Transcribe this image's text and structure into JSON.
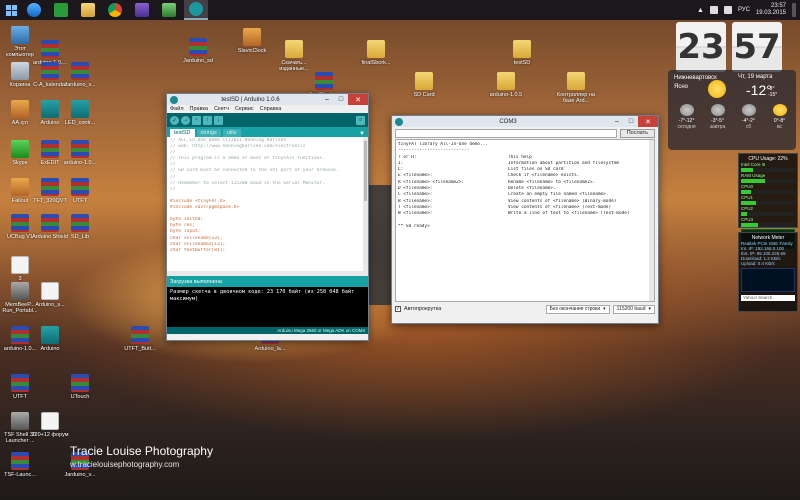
{
  "taskbar": {
    "buttons": [
      "ie",
      "store",
      "chrome",
      "video",
      "explorer",
      "task-manager",
      "arduino"
    ],
    "tray": {
      "lang": "РУС",
      "time": "23:57",
      "date": "19.03.2015"
    }
  },
  "desktop_icons": [
    {
      "label": "Этот компьютер",
      "kind": "pc"
    },
    {
      "label": "arduino-1.0....",
      "kind": "rar"
    },
    {
      "label": "Корзина",
      "kind": "bin"
    },
    {
      "label": "C-A_kalendar",
      "kind": "rar"
    },
    {
      "label": "Jarduino_v...",
      "kind": "rar"
    },
    {
      "label": "AA.q:n",
      "kind": "app"
    },
    {
      "label": "Arduino",
      "kind": "ard"
    },
    {
      "label": "LED_contr...",
      "kind": "ard"
    },
    {
      "label": "Skype",
      "kind": "green"
    },
    {
      "label": "ExEDIT",
      "kind": "rar"
    },
    {
      "label": "arduino-1.0...",
      "kind": "rar"
    },
    {
      "label": "Fallout",
      "kind": "app"
    },
    {
      "label": "TFT_320QVT",
      "kind": "rar"
    },
    {
      "label": "UTFT",
      "kind": "rar"
    },
    {
      "label": "UCBug V1",
      "kind": "rar"
    },
    {
      "label": "Arduino Shield",
      "kind": "rar"
    },
    {
      "label": "SD_Lib",
      "kind": "rar"
    },
    {
      "label": "3",
      "kind": "doc"
    },
    {
      "label": "MemBeeP... Run_Portabl...",
      "kind": "grey"
    },
    {
      "label": "Arduino_s...",
      "kind": "doc"
    },
    {
      "label": "arduino-1.0...",
      "kind": "rar"
    },
    {
      "label": "Arduino",
      "kind": "ard"
    },
    {
      "label": "UTFT_Butt...",
      "kind": "rar"
    },
    {
      "label": "Arduino_la...",
      "kind": "rar"
    },
    {
      "label": "UTFT",
      "kind": "rar"
    },
    {
      "label": "UTouch",
      "kind": "rar"
    },
    {
      "label": "TSF Shell 30 Launcher ...",
      "kind": "grey"
    },
    {
      "label": "220+12 форум",
      "kind": "doc"
    },
    {
      "label": "TSF-Launc...",
      "kind": "rar"
    },
    {
      "label": "Jarduino_v...",
      "kind": "rar"
    },
    {
      "label": "Jarduino_sd",
      "kind": "rar"
    },
    {
      "label": "SlavicClock",
      "kind": "app"
    },
    {
      "label": "Скачать... изданные...",
      "kind": "folder"
    },
    {
      "label": "finalSbork...",
      "kind": "folder"
    },
    {
      "label": "testSD",
      "kind": "folder"
    },
    {
      "label": "finalSbork...",
      "kind": "rar"
    },
    {
      "label": "SD Card",
      "kind": "folder"
    },
    {
      "label": "arduino-1.0.5",
      "kind": "folder"
    },
    {
      "label": "Контроллер на базе Ard...",
      "kind": "folder"
    }
  ],
  "ide": {
    "title": "testSD | Arduino 1.0.6",
    "menu": [
      "Файл",
      "Правка",
      "Скетч",
      "Сервис",
      "Справка"
    ],
    "tabs": [
      "testSD",
      "strings",
      "utils"
    ],
    "code": [
      "// ALL_In_One_Demo (C)2011 Henning Karlsen",
      "// web: http://www.henningkarlsen.com/electronics",
      "//",
      "// This program is a demo of most of tinyFATs functions.",
      "//",
      "// SD card must be connected to the SPI port of your Arduino.",
      "//",
      "// Remember to select 115200 baud in the Serial Monitor.",
      "//",
      "",
      "#include <tinyFAT.h>",
      "#include <avr/pgmspace.h>",
      "",
      "byte inited;",
      "byte res;",
      "byte input;",
      "char sFilename[13];",
      "char sFilename2[13];",
      "char textBuffer[81];"
    ],
    "status": "Загрузка выполнена",
    "console": [
      "Размер скетча в двоичном коде: 23 170 байт (из 258 048 байт",
      "максимум)"
    ],
    "board": "Arduino Mega 2560 or Mega ADK on COM3"
  },
  "serial": {
    "title": "COM3",
    "send_label": "Послать",
    "lines": [
      {
        "c1": "tinyFAT library All-In-One demo...",
        "c2": ""
      },
      {
        "c1": "---------------------------",
        "c2": ""
      },
      {
        "c1": "? or H:",
        "c2": "This help"
      },
      {
        "c1": "I:",
        "c2": "Information about partition and filesystem"
      },
      {
        "c1": "L:",
        "c2": "List files on SD card"
      },
      {
        "c1": "E <filename>:",
        "c2": "Check if <filename> exists."
      },
      {
        "c1": "R <filename> <filename2>:",
        "c2": "Rename <filename> to <filename2>."
      },
      {
        "c1": "D <filename>:",
        "c2": "Delete <filename>."
      },
      {
        "c1": "C <filename>:",
        "c2": "Create an empty file named <filename>."
      },
      {
        "c1": "B <filename>:",
        "c2": "View contents of <filename> (Binary-mode)"
      },
      {
        "c1": "T <filename>:",
        "c2": "View contents of <filename> (Text-mode)"
      },
      {
        "c1": "W <filename>:",
        "c2": "Write a line of text to <filename> (Text-mode)"
      },
      {
        "c1": "",
        "c2": ""
      },
      {
        "c1": "** SD ready>",
        "c2": ""
      }
    ],
    "autoscroll": "Автопрокрутка",
    "line_ending": "Без окончания строки",
    "baud": "115200 baud"
  },
  "gadgets": {
    "hours": "23",
    "minutes": "57",
    "city": "Нижневартовск",
    "condition": "Ясно",
    "date": "Чт, 19 марта",
    "temp": "-12°",
    "range": [
      "-3°",
      "-15°"
    ],
    "forecast": [
      {
        "t": "-7°-12°",
        "d": "сегодня"
      },
      {
        "t": "-3°-5°",
        "d": "завтра"
      },
      {
        "t": "-4°-2°",
        "d": "сб"
      },
      {
        "t": "0°-8°",
        "d": "вс"
      }
    ],
    "cpu_title": "CPU Usage: 22%",
    "cpu_lines": [
      "Intel Core i5",
      "RAM Usage",
      "CPU0",
      "CPU1",
      "CPU2",
      "CPU3"
    ],
    "cpu_values": [
      0.22,
      0.45,
      0.18,
      0.27,
      0.12,
      0.31
    ],
    "net_title": "Network Meter",
    "net_lines": [
      "Realtek PCIe GBE Family",
      "Int. IP: 192.168.0.100",
      "Ext. IP: 95.105.226.69",
      "Download: 1.2 KB/s",
      "Upload: 0.4 KB/s"
    ],
    "net_search": "Yahoo! Search"
  },
  "watermark": {
    "line1": "Tracie Louise Photography",
    "line2": "w.tracielouisephotography.com"
  }
}
